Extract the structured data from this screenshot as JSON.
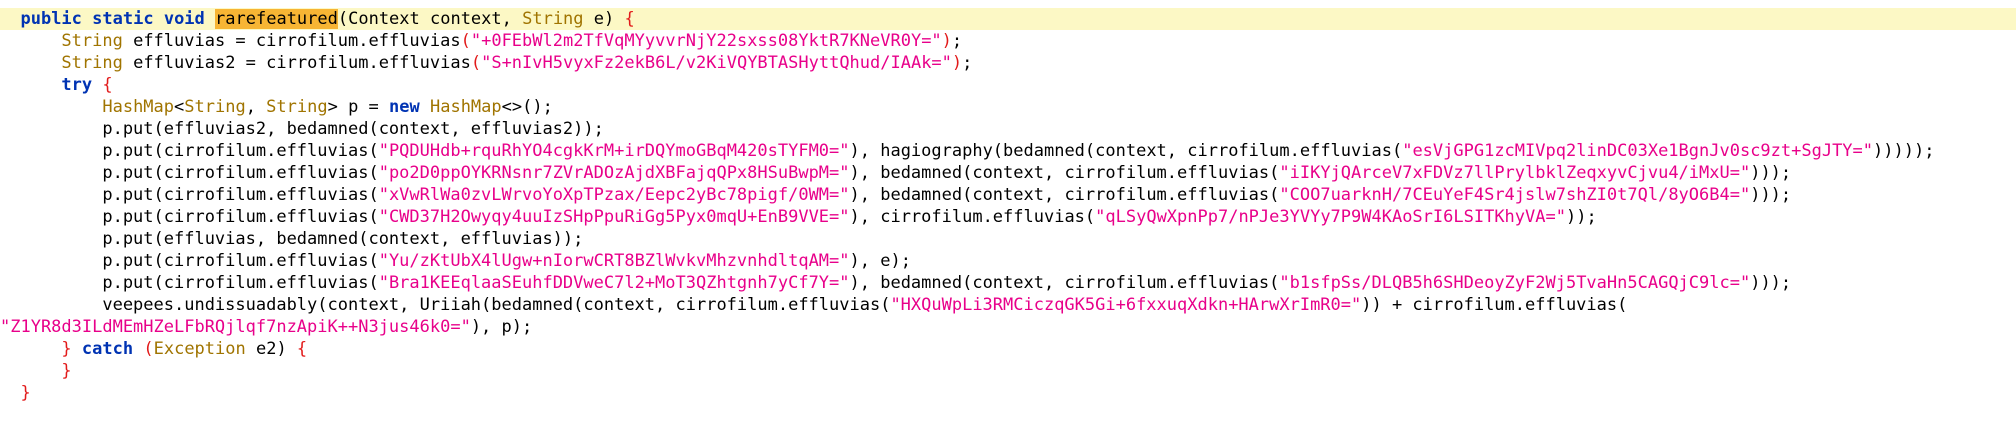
{
  "editor": {
    "lines": [
      [
        [
          "  ",
          ""
        ],
        [
          "public",
          "kw"
        ],
        [
          " ",
          ""
        ],
        [
          "static",
          "kw"
        ],
        [
          " ",
          ""
        ],
        [
          "void",
          "kw"
        ],
        [
          " ",
          ""
        ],
        [
          "raref",
          "hl"
        ],
        [
          "|",
          "caret"
        ],
        [
          "eatured",
          "hl"
        ],
        [
          "(Context context, ",
          ""
        ],
        [
          "String",
          "ty"
        ],
        [
          " e) ",
          ""
        ],
        [
          "{",
          "br"
        ]
      ],
      [
        [
          "      ",
          ""
        ],
        [
          "String",
          "ty"
        ],
        [
          " effluvias = cirrofilum.effluvias",
          ""
        ],
        [
          "(",
          "br"
        ],
        [
          "\"+0FEbWl2m2TfVqMYyvvrNjY22sxss08YktR7KNeVR0Y=\"",
          "str"
        ],
        [
          ")",
          "br"
        ],
        [
          ";",
          ""
        ]
      ],
      [
        [
          "      ",
          ""
        ],
        [
          "String",
          "ty"
        ],
        [
          " effluvias2 = cirrofilum.effluvias",
          ""
        ],
        [
          "(",
          "br"
        ],
        [
          "\"S+nIvH5vyxFz2ekB6L/v2KiVQYBTASHyttQhud/IAAk=\"",
          "str"
        ],
        [
          ")",
          "br"
        ],
        [
          ";",
          ""
        ]
      ],
      [
        [
          "      ",
          ""
        ],
        [
          "try",
          "kw"
        ],
        [
          " ",
          ""
        ],
        [
          "{",
          "br"
        ]
      ],
      [
        [
          "          ",
          ""
        ],
        [
          "HashMap",
          "ty"
        ],
        [
          "<",
          ""
        ],
        [
          "String",
          "ty"
        ],
        [
          ", ",
          ""
        ],
        [
          "String",
          "ty"
        ],
        [
          "> p = ",
          ""
        ],
        [
          "new",
          "kw"
        ],
        [
          " ",
          ""
        ],
        [
          "HashMap",
          "ty"
        ],
        [
          "<>()",
          ""
        ],
        [
          ";",
          ""
        ]
      ],
      [
        [
          "          p.put(effluvias2, bedamned(context, effluvias2));",
          ""
        ]
      ],
      [
        [
          "          p.put(cirrofilum.effluvias(",
          ""
        ],
        [
          "\"PQDUHdb+rquRhYO4cgkKrM+irDQYmoGBqM420sTYFM0=\"",
          "str"
        ],
        [
          "), hagiography(bedamned(context, cirrofilum.effluvias(",
          ""
        ],
        [
          "\"esVjGPG1zcMIVpq2linDC03Xe1BgnJv0sc9zt+SgJTY=\"",
          "str"
        ],
        [
          ")))));",
          ""
        ]
      ],
      [
        [
          "          p.put(cirrofilum.effluvias(",
          ""
        ],
        [
          "\"po2D0ppOYKRNsnr7ZVrADOzAjdXBFajqQPx8HSuBwpM=\"",
          "str"
        ],
        [
          "), bedamned(context, cirrofilum.effluvias(",
          ""
        ],
        [
          "\"iIKYjQArceV7xFDVz7llPrylbklZeqxyvCjvu4/iMxU=\"",
          "str"
        ],
        [
          ")));",
          ""
        ]
      ],
      [
        [
          "          p.put(cirrofilum.effluvias(",
          ""
        ],
        [
          "\"xVwRlWa0zvLWrvoYoXpTPzax/Eepc2yBc78pigf/0WM=\"",
          "str"
        ],
        [
          "), bedamned(context, cirrofilum.effluvias(",
          ""
        ],
        [
          "\"COO7uarknH/7CEuYeF4Sr4jslw7shZI0t7Ql/8yO6B4=\"",
          "str"
        ],
        [
          ")));",
          ""
        ]
      ],
      [
        [
          "          p.put(cirrofilum.effluvias(",
          ""
        ],
        [
          "\"CWD37H2Owyqy4uuIzSHpPpuRiGg5Pyx0mqU+EnB9VVE=\"",
          "str"
        ],
        [
          "), cirrofilum.effluvias(",
          ""
        ],
        [
          "\"qLSyQwXpnPp7/nPJe3YVYy7P9W4KAoSrI6LSITKhyVA=\"",
          "str"
        ],
        [
          "));",
          ""
        ]
      ],
      [
        [
          "          p.put(effluvias, bedamned(context, effluvias));",
          ""
        ]
      ],
      [
        [
          "          p.put(cirrofilum.effluvias(",
          ""
        ],
        [
          "\"Yu/zKtUbX4lUgw+nIorwCRT8BZlWvkvMhzvnhdltqAM=\"",
          "str"
        ],
        [
          "), e);",
          ""
        ]
      ],
      [
        [
          "          p.put(cirrofilum.effluvias(",
          ""
        ],
        [
          "\"Bra1KEEqlaaSEuhfDDVweC7l2+MoT3QZhtgnh7yCf7Y=\"",
          "str"
        ],
        [
          "), bedamned(context, cirrofilum.effluvias(",
          ""
        ],
        [
          "\"b1sfpSs/DLQB5h6SHDeoyZyF2Wj5TvaHn5CAGQjC9lc=\"",
          "str"
        ],
        [
          ")));",
          ""
        ]
      ],
      [
        [
          "          veepees.undissuadably(context, Uriiah(bedamned(context, cirrofilum.effluvias(",
          ""
        ],
        [
          "\"HXQuWpLi3RMCiczqGK5Gi+6fxxuqXdkn+HArwXrImR0=\"",
          "str"
        ],
        [
          ")) + cirrofilum.effluvias(",
          ""
        ]
      ],
      [
        [
          "\"Z1YR8d3ILdMEmHZeLFbRQjlqf7nzApiK++N3jus46k0=\"",
          "str"
        ],
        [
          "), p);",
          ""
        ]
      ],
      [
        [
          "      ",
          ""
        ],
        [
          "}",
          "br"
        ],
        [
          " ",
          ""
        ],
        [
          "catch",
          "kw"
        ],
        [
          " ",
          ""
        ],
        [
          "(",
          "br"
        ],
        [
          "Exception",
          "ty"
        ],
        [
          " e2) ",
          ""
        ],
        [
          "{",
          "br"
        ]
      ],
      [
        [
          "      ",
          ""
        ],
        [
          "}",
          "br"
        ]
      ],
      [
        [
          "  ",
          ""
        ],
        [
          "}",
          "br"
        ]
      ]
    ]
  }
}
